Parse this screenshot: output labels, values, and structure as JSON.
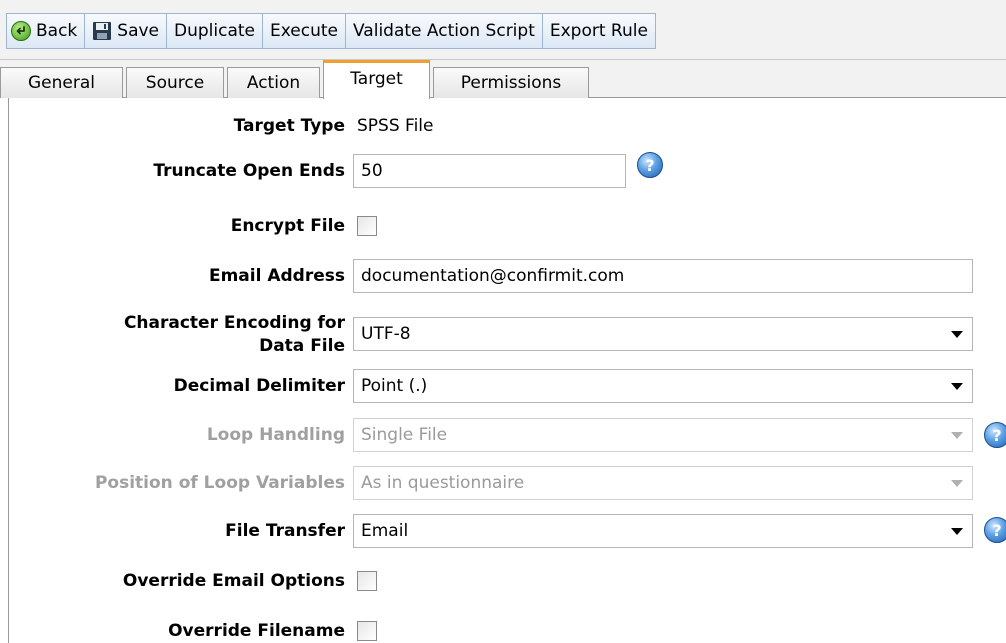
{
  "toolbar": {
    "buttons": [
      {
        "label": "Back",
        "icon": "back-arrow-icon"
      },
      {
        "label": "Save",
        "icon": "floppy-disk-icon"
      },
      {
        "label": "Duplicate"
      },
      {
        "label": "Execute"
      },
      {
        "label": "Validate Action Script"
      },
      {
        "label": "Export Rule"
      }
    ]
  },
  "tabs": [
    {
      "label": "General",
      "active": false
    },
    {
      "label": "Source",
      "active": false
    },
    {
      "label": "Action",
      "active": false
    },
    {
      "label": "Target",
      "active": true
    },
    {
      "label": "Permissions",
      "active": false
    }
  ],
  "form": {
    "target_type": {
      "label": "Target Type",
      "value": "SPSS File"
    },
    "truncate_open_ends": {
      "label": "Truncate Open Ends",
      "value": "50"
    },
    "encrypt_file": {
      "label": "Encrypt File",
      "checked": false
    },
    "email_address": {
      "label": "Email Address",
      "value": "documentation@confirmit.com"
    },
    "character_encoding": {
      "label_line1": "Character Encoding for",
      "label_line2": "Data File",
      "value": "UTF-8"
    },
    "decimal_delimiter": {
      "label": "Decimal Delimiter",
      "value": "Point (.)"
    },
    "loop_handling": {
      "label": "Loop Handling",
      "value": "Single File",
      "disabled": true
    },
    "position_loop_variables": {
      "label": "Position of Loop Variables",
      "value": "As in questionnaire",
      "disabled": true
    },
    "file_transfer": {
      "label": "File Transfer",
      "value": "Email"
    },
    "override_email_options": {
      "label": "Override Email Options",
      "checked": false
    },
    "override_filename": {
      "label": "Override Filename",
      "checked": false
    }
  },
  "colors": {
    "active_tab_accent": "#f0a030",
    "toolbar_gradient_top": "#f7fafd",
    "toolbar_gradient_bottom": "#dce8f5",
    "disabled_text": "#a0a0a0",
    "help_icon_blue": "#1e5fae"
  }
}
